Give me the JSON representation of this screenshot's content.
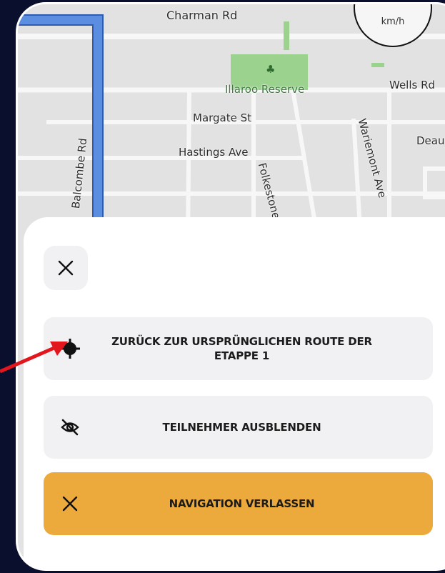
{
  "map": {
    "streets": [
      "Charman Rd",
      "Illaroo Reserve",
      "Wells Rd",
      "Margate St",
      "Hastings Ave",
      "Folkestone Cr",
      "Wariemont Ave",
      "Balcombe Rd",
      "Deau"
    ],
    "speed_unit": "km/h"
  },
  "sheet": {
    "close_icon": "close-icon",
    "buttons": [
      {
        "label": "ZURÜCK ZUR URSPRÜNGLICHEN ROUTE DER ETAPPE 1",
        "icon": "crosshair-icon"
      },
      {
        "label": "TEILNEHMER AUSBLENDEN",
        "icon": "eye-off-icon"
      },
      {
        "label": "NAVIGATION VERLASSEN",
        "icon": "close-icon"
      }
    ]
  },
  "colors": {
    "exit_button": "#eca93c",
    "route_line": "#4a7fd8",
    "annotation_arrow": "#e3161d"
  }
}
